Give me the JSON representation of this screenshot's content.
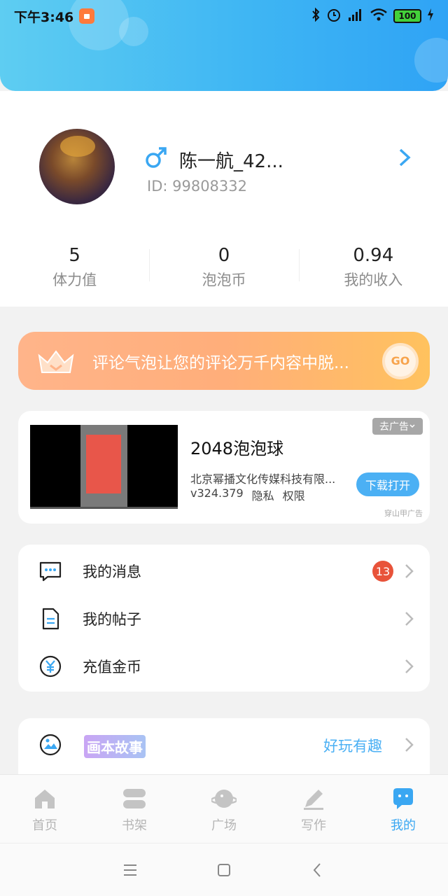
{
  "status_bar": {
    "time": "下午3:46",
    "battery": "100"
  },
  "profile": {
    "username": "陈一航_42...",
    "id_label": "ID: 99808332",
    "stats": [
      {
        "value": "5",
        "label": "体力值"
      },
      {
        "value": "0",
        "label": "泡泡币"
      },
      {
        "value": "0.94",
        "label": "我的收入"
      }
    ]
  },
  "promo": {
    "text": "评论气泡让您的评论万千内容中脱...",
    "button": "GO"
  },
  "ad": {
    "dismiss": "去广告",
    "title": "2048泡泡球",
    "company": "北京幂播文化传媒科技有限...",
    "version": "v324.379",
    "privacy": "隐私",
    "permissions": "权限",
    "download": "下载打开",
    "source": "穿山甲广告"
  },
  "menu": {
    "items": [
      {
        "label": "我的消息",
        "badge": "13"
      },
      {
        "label": "我的帖子"
      },
      {
        "label": "充值金币"
      }
    ]
  },
  "story": {
    "logo": "画本故事",
    "tag": "好玩有趣"
  },
  "tabs": [
    {
      "label": "首页"
    },
    {
      "label": "书架"
    },
    {
      "label": "广场"
    },
    {
      "label": "写作"
    },
    {
      "label": "我的"
    }
  ],
  "colors": {
    "accent": "#3aa7f2",
    "badge": "#e8533a",
    "promo": "#ffb48a"
  }
}
